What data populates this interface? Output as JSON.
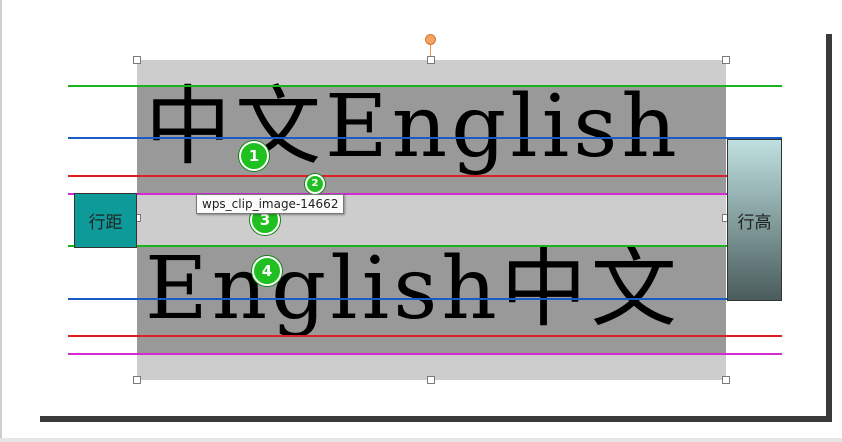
{
  "figure": {
    "line1_text": "中文English",
    "line2_text": "English中文",
    "label_line_spacing": "行距",
    "label_line_height": "行高",
    "tooltip": "wps_clip_image-14662",
    "markers": [
      "1",
      "2",
      "3",
      "4"
    ]
  },
  "colors": {
    "baseline_green": "#1db31d",
    "ascender_blue": "#1a5cc7",
    "descender_red": "#e02020",
    "bottom_magenta": "#d42ad4",
    "text_background": "#999999",
    "frame_background": "#cdcdcd",
    "line_spacing_label": "#0f9a9a",
    "badge": "#20c020"
  },
  "icons": {
    "rotation_handle": "rotate-handle-icon",
    "resize_handles": "resize-handle-icon"
  }
}
